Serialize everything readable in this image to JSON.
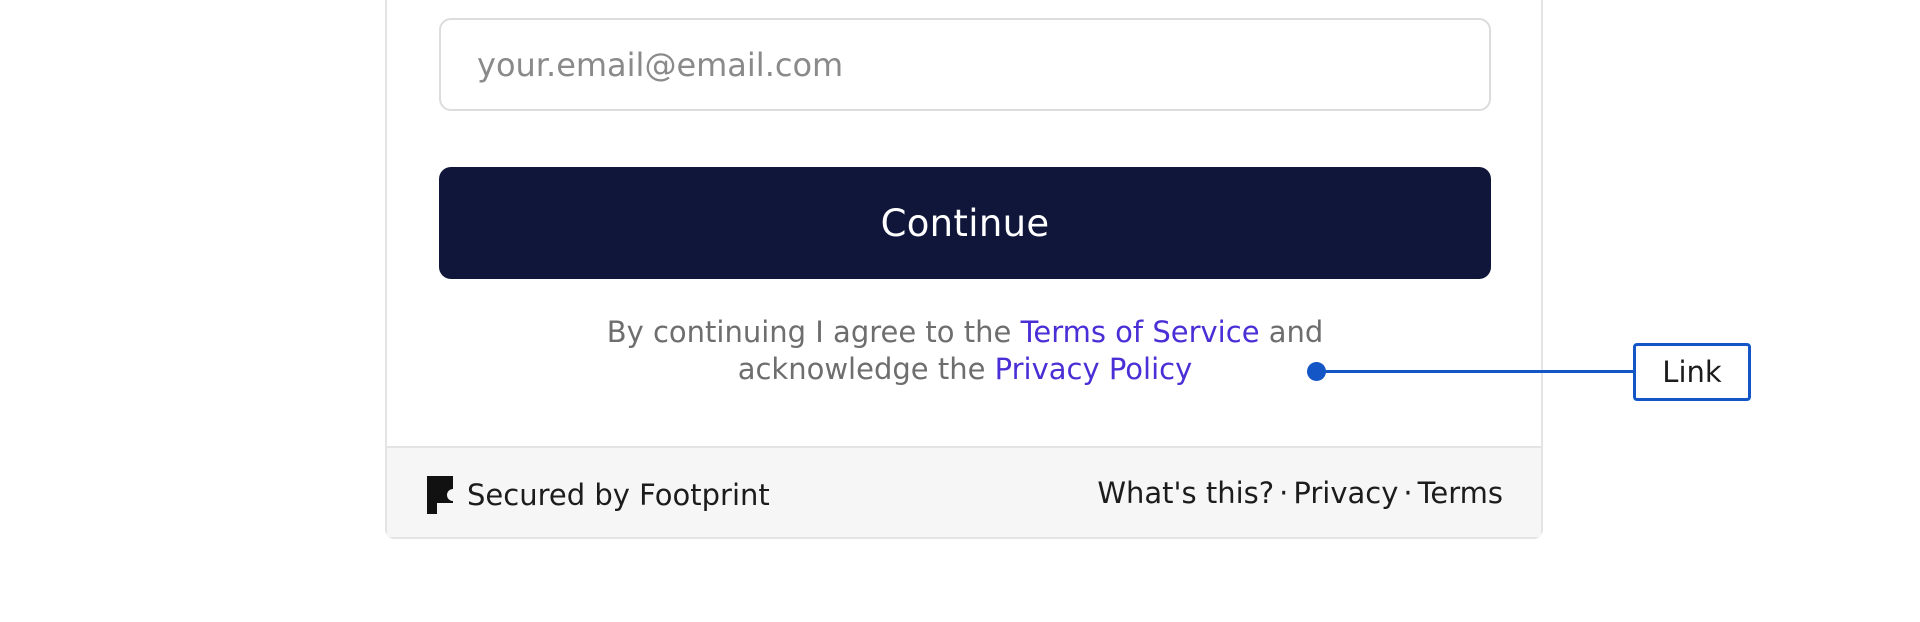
{
  "email": {
    "placeholder": "your.email@email.com",
    "value": ""
  },
  "continue_button": {
    "label": "Continue"
  },
  "legal": {
    "prefix": "By continuing I agree to the",
    "terms_link": "Terms of Service",
    "middle": "and",
    "middle2": "acknowledge the",
    "privacy_link": "Privacy Policy"
  },
  "footer": {
    "brand": "Secured by Footprint",
    "brand_icon": "footprint-logo-icon",
    "links": [
      "What's this?",
      "Privacy",
      "Terms"
    ],
    "separator": "·"
  },
  "annotation": {
    "label": "Link"
  },
  "colors": {
    "button_bg": "#10163a",
    "link": "#4a2fd6",
    "annotation": "#1456c6",
    "footer_bg": "#f6f6f6"
  }
}
